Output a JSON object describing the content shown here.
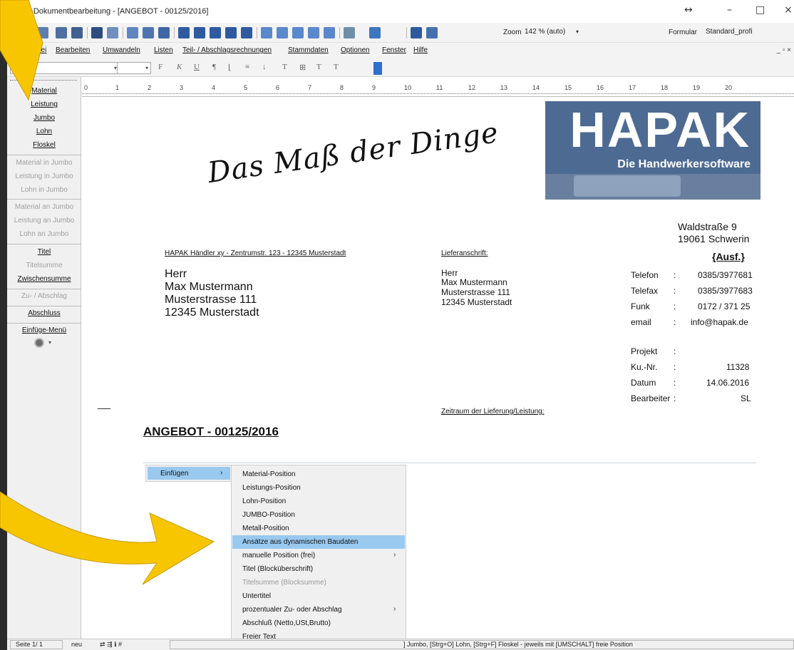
{
  "window": {
    "title": "PAK-Dokumentbearbeitung - [ANGEBOT - 00125/2016]",
    "controls": {
      "restore": "↔",
      "minimize": "–",
      "maximize": "□",
      "close": "×"
    }
  },
  "toolbar": {
    "zoom_label": "Zoom",
    "zoom_value": "142 % (auto)",
    "formular_label": "Formular",
    "formular_value": "Standard_profi"
  },
  "menu": {
    "items": [
      "Datei",
      "Bearbeiten",
      "Umwandeln",
      "Listen",
      "Teil- / Abschlagsrechnungen",
      "Stammdaten",
      "Optionen",
      "Fenster",
      "Hilfe"
    ],
    "mdi_controls": "_ ▫ ×"
  },
  "formatbar": {
    "buttons": [
      "F",
      "K",
      "U",
      "¶"
    ]
  },
  "sidebar": {
    "items": [
      {
        "label": "Material",
        "enabled": true
      },
      {
        "label": "Leistung",
        "enabled": true
      },
      {
        "label": "Jumbo",
        "enabled": true
      },
      {
        "label": "Lohn",
        "enabled": true
      },
      {
        "label": "Floskel",
        "enabled": true
      },
      {
        "label": "Material in Jumbo",
        "enabled": false
      },
      {
        "label": "Leistung in Jumbo",
        "enabled": false
      },
      {
        "label": "Lohn in Jumbo",
        "enabled": false
      },
      {
        "label": "Material an Jumbo",
        "enabled": false
      },
      {
        "label": "Leistung an Jumbo",
        "enabled": false
      },
      {
        "label": "Lohn an Jumbo",
        "enabled": false
      },
      {
        "label": "Titel",
        "enabled": true
      },
      {
        "label": "Titelsumme",
        "enabled": false
      },
      {
        "label": "Zwischensumme",
        "enabled": true
      },
      {
        "label": "Zu- / Abschlag",
        "enabled": false
      },
      {
        "label": "Abschluss",
        "enabled": true
      },
      {
        "label": "Einfüge-Menü",
        "enabled": true
      }
    ]
  },
  "ruler": {
    "marks": [
      "0",
      "1",
      "2",
      "3",
      "4",
      "5",
      "6",
      "7",
      "8",
      "9",
      "10",
      "11",
      "12",
      "13",
      "14",
      "15",
      "16",
      "17",
      "18",
      "19",
      "20"
    ]
  },
  "document": {
    "slogan": "Das Maß der Dinge",
    "logo_title": "HAPAK",
    "logo_subtitle": "Die Handwerkersoftware",
    "company_street": "Waldstraße 9",
    "company_city": "19061 Schwerin",
    "sender_line": "HAPAK Händler xy  - Zentrumstr. 123 - 12345 Musterstadt",
    "address": [
      "Herr",
      "Max Mustermann",
      "Musterstrasse 111",
      "12345 Musterstadt"
    ],
    "delivery_label": "Lieferanschrift:",
    "delivery_address": [
      "Herr",
      "Max Mustermann",
      "Musterstrasse 111",
      "12345 Musterstadt"
    ],
    "ausf": "{Ausf.}",
    "contacts": [
      {
        "label": "Telefon",
        "sep": ":",
        "value": "0385/3977681"
      },
      {
        "label": "Telefax",
        "sep": ":",
        "value": "0385/3977683"
      },
      {
        "label": "Funk",
        "sep": ":",
        "value": "0172 / 371 25"
      },
      {
        "label": "email",
        "sep": ":",
        "value": "info@hapak.de"
      }
    ],
    "meta": [
      {
        "label": "Projekt",
        "sep": ":",
        "value": ""
      },
      {
        "label": "Ku.-Nr.",
        "sep": ":",
        "value": "11328"
      },
      {
        "label": "Datum",
        "sep": ":",
        "value": "14.06.2016"
      },
      {
        "label": "Bearbeiter",
        "sep": ":",
        "value": "SL"
      }
    ],
    "zeitraum": "Zeitraum der Lieferung/Leistung:",
    "heading": "ANGEBOT - 00125/2016"
  },
  "context_menu": {
    "label": "Einfügen",
    "arrow": "›",
    "submenu": [
      {
        "label": "Material-Position",
        "enabled": true,
        "submenu": false,
        "highlighted": false
      },
      {
        "label": "Leistungs-Position",
        "enabled": true,
        "submenu": false,
        "highlighted": false
      },
      {
        "label": "Lohn-Position",
        "enabled": true,
        "submenu": false,
        "highlighted": false
      },
      {
        "label": "JUMBO-Position",
        "enabled": true,
        "submenu": false,
        "highlighted": false
      },
      {
        "label": "Metall-Position",
        "enabled": true,
        "submenu": false,
        "highlighted": false
      },
      {
        "label": "Ansätze aus dynamischen Baudaten",
        "enabled": true,
        "submenu": false,
        "highlighted": true
      },
      {
        "label": "manuelle Position (frei)",
        "enabled": true,
        "submenu": true,
        "highlighted": false
      },
      {
        "label": "Titel (Blocküberschrift)",
        "enabled": true,
        "submenu": false,
        "highlighted": false
      },
      {
        "label": "Titelsumme (Blocksumme)",
        "enabled": false,
        "submenu": false,
        "highlighted": false
      },
      {
        "label": "Untertitel",
        "enabled": true,
        "submenu": false,
        "highlighted": false
      },
      {
        "label": "prozentualer Zu- oder Abschlag",
        "enabled": true,
        "submenu": true,
        "highlighted": false
      },
      {
        "label": "Abschluß (Netto,USt,Brutto)",
        "enabled": true,
        "submenu": false,
        "highlighted": false
      },
      {
        "label": "Freier Text",
        "enabled": true,
        "submenu": false,
        "highlighted": false
      }
    ]
  },
  "statusbar": {
    "page": "Seite  1/ 1",
    "mode": "neu",
    "hint": "] Jumbo, [Strg+O] Lohn, [Strg+F] Floskel - jeweils mit [UMSCHALT] freie Position"
  },
  "colors": {
    "accent_highlight": "#99c9ef",
    "logo_blue": "#4d6a92",
    "arrow_yellow": "#f7c600"
  }
}
